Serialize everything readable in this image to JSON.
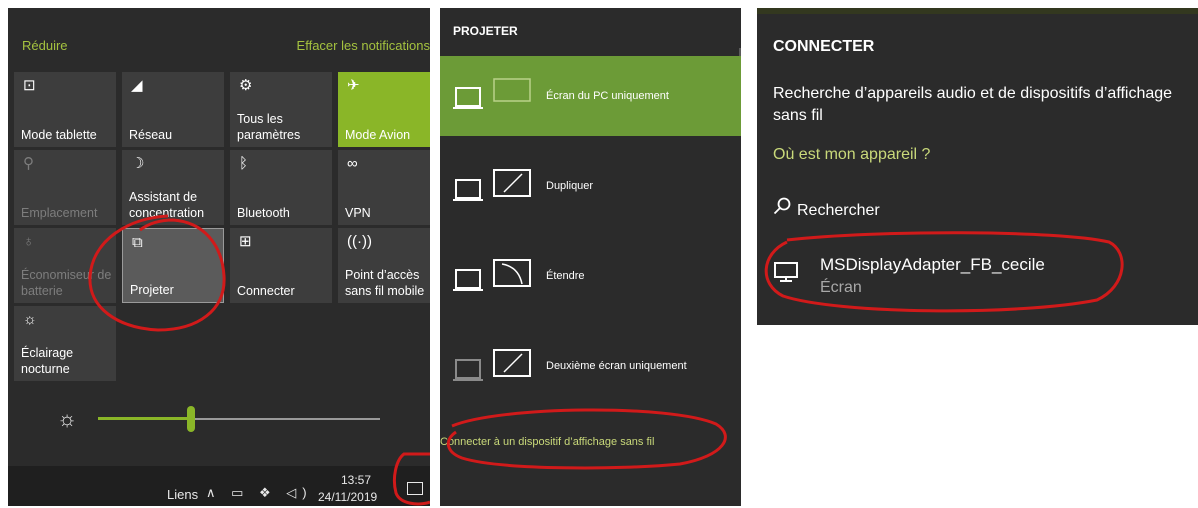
{
  "action_center": {
    "collapse_label": "Réduire",
    "clear_label": "Effacer les notifications",
    "tiles": [
      {
        "label": "Mode tablette",
        "icon": "tablet-mode-icon",
        "glyph": "⊡",
        "state": "normal"
      },
      {
        "label": "Réseau",
        "icon": "network-icon",
        "glyph": "◢",
        "state": "normal"
      },
      {
        "label": "Tous les paramètres",
        "icon": "gear-icon",
        "glyph": "⚙",
        "state": "normal"
      },
      {
        "label": "Mode Avion",
        "icon": "airplane-icon",
        "glyph": "✈",
        "state": "active"
      },
      {
        "label": "Emplacement",
        "icon": "location-icon",
        "glyph": "⚲",
        "state": "disabled"
      },
      {
        "label": "Assistant de concentration",
        "icon": "moon-icon",
        "glyph": "☽",
        "state": "normal"
      },
      {
        "label": "Bluetooth",
        "icon": "bluetooth-icon",
        "glyph": "ᛒ",
        "state": "normal"
      },
      {
        "label": "VPN",
        "icon": "vpn-icon",
        "glyph": "∞",
        "state": "normal"
      },
      {
        "label": "Économiseur de batterie",
        "icon": "battery-saver-icon",
        "glyph": "♁",
        "state": "disabled"
      },
      {
        "label": "Projeter",
        "icon": "project-icon",
        "glyph": "⧉",
        "state": "hover"
      },
      {
        "label": "Connecter",
        "icon": "connect-icon",
        "glyph": "⊞",
        "state": "normal"
      },
      {
        "label": "Point d’accès sans fil mobile",
        "icon": "hotspot-icon",
        "glyph": "((·))",
        "state": "normal"
      },
      {
        "label": "Éclairage nocturne",
        "icon": "night-light-icon",
        "glyph": "☼",
        "state": "normal"
      }
    ],
    "brightness_fraction": 0.33,
    "accent_color": "#8ab628"
  },
  "taskbar": {
    "links_label": "Liens",
    "tray_icons": "∧ ▭ ❖ ◁)",
    "time": "13:57",
    "date": "24/11/2019"
  },
  "project": {
    "title": "PROJETER",
    "options": [
      {
        "label": "Écran du PC uniquement",
        "selected": true
      },
      {
        "label": "Dupliquer",
        "selected": false
      },
      {
        "label": "Étendre",
        "selected": false
      },
      {
        "label": "Deuxième écran uniquement",
        "selected": false
      }
    ],
    "connect_link": "Connecter à un dispositif d’affichage sans fil",
    "selected_color": "#6c9b37"
  },
  "connect": {
    "title": "CONNECTER",
    "description": "Recherche d’appareils audio et de dispositifs d’affichage sans fil",
    "where_link": "Où est mon appareil ?",
    "search_label": "Rechercher",
    "device": {
      "name": "MSDisplayAdapter_FB_cecile",
      "type": "Écran"
    }
  },
  "annotation_color": "#d11a1a"
}
